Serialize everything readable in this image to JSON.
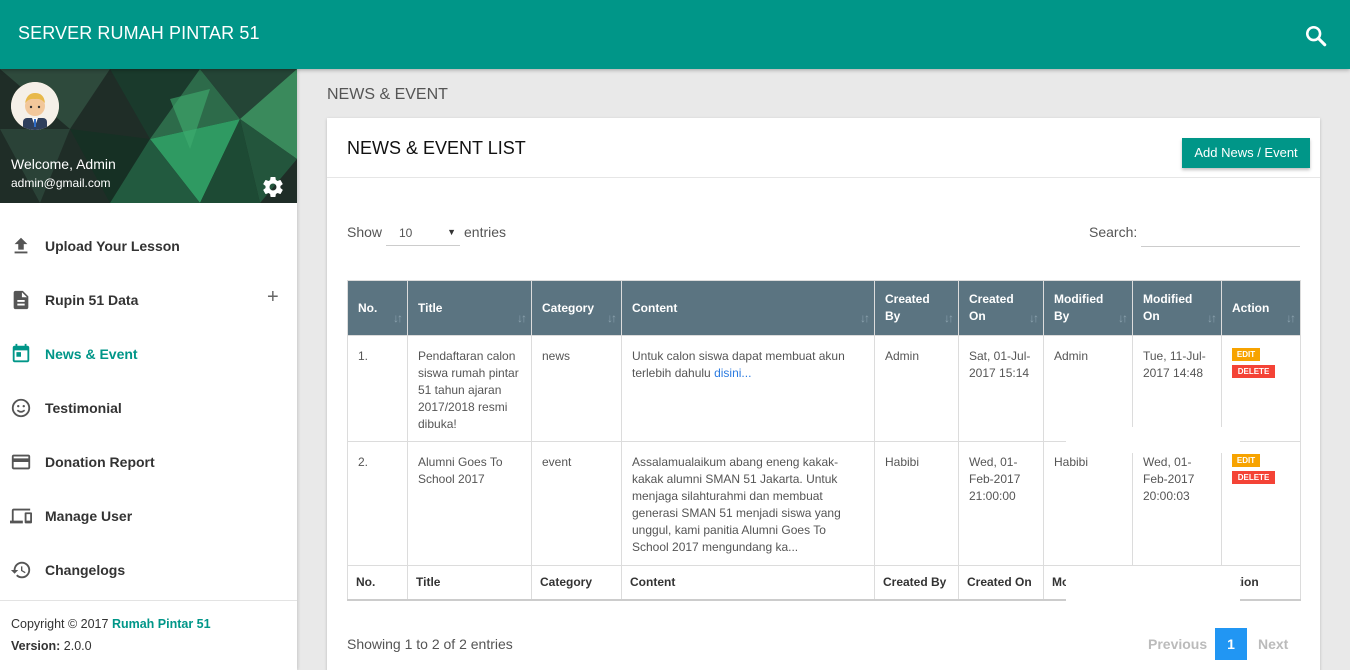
{
  "app": {
    "title": "SERVER RUMAH PINTAR 51"
  },
  "user": {
    "welcome": "Welcome, Admin",
    "email": "admin@gmail.com"
  },
  "menu": {
    "upload": "Upload Your Lesson",
    "rupin": "Rupin 51 Data",
    "news": "News & Event",
    "testimonial": "Testimonial",
    "donation": "Donation Report",
    "manage": "Manage User",
    "changelogs": "Changelogs",
    "expand_symbol": "+"
  },
  "footer": {
    "copyright_prefix": "Copyright © 2017 ",
    "brand": "Rumah Pintar 51",
    "version_label": "Version:",
    "version_value": " 2.0.0"
  },
  "page": {
    "title": "NEWS & EVENT",
    "card_title": "NEWS & EVENT LIST",
    "add_button": "Add News / Event"
  },
  "controls": {
    "show": "Show",
    "page_length": "10",
    "entries": "entries",
    "search": "Search:",
    "search_value": ""
  },
  "table": {
    "headers": {
      "no": "No.",
      "title": "Title",
      "category": "Category",
      "content": "Content",
      "created_by_1": "Created",
      "created_by_2": "By",
      "created_on_1": "Created",
      "created_on_2": "On",
      "modified_by_1": "Modified",
      "modified_by_2": "By",
      "modified_on_1": "Modified",
      "modified_on_2": "On",
      "action": "Action"
    },
    "footer": {
      "no": "No.",
      "title": "Title",
      "category": "Category",
      "content": "Content",
      "created_by": "Created By",
      "created_on": "Created On",
      "modified_by": "Mo",
      "action": "ction"
    },
    "rows": [
      {
        "no": "1.",
        "title": "Pendaftaran calon siswa rumah pintar 51 tahun ajaran 2017/2018 resmi dibuka!",
        "category": "news",
        "content": "Untuk calon siswa dapat membuat akun terlebih dahulu ",
        "content_link": "disini...",
        "created_by": "Admin",
        "created_on": "Sat, 01-Jul-2017 15:14",
        "modified_by": "Admin",
        "modified_on": "Tue, 11-Jul-2017 14:48",
        "edit": "EDIT",
        "delete": "DELETE"
      },
      {
        "no": "2.",
        "title": "Alumni Goes To School 2017",
        "category": "event",
        "content": "Assalamualaikum abang eneng kakak-kakak alumni SMAN 51 Jakarta. Untuk menjaga silahturahmi dan membuat generasi SMAN 51 menjadi siswa yang unggul, kami panitia Alumni Goes To School 2017 mengundang ka...",
        "created_by": "Habibi",
        "created_on": "Wed, 01-Feb-2017 21:00:00",
        "modified_by": "Habibi",
        "modified_on": "Wed, 01-Feb-2017 20:00:03",
        "edit": "EDIT",
        "delete": "DELETE"
      }
    ]
  },
  "pagination": {
    "info": "Showing 1 to 2 of 2 entries",
    "previous": "Previous",
    "current": "1",
    "next": "Next"
  },
  "colors": {
    "primary": "#009688",
    "header_row": "#5b7481",
    "edit": "#f7a300",
    "delete": "#f44336",
    "page_active": "#2196f3"
  }
}
